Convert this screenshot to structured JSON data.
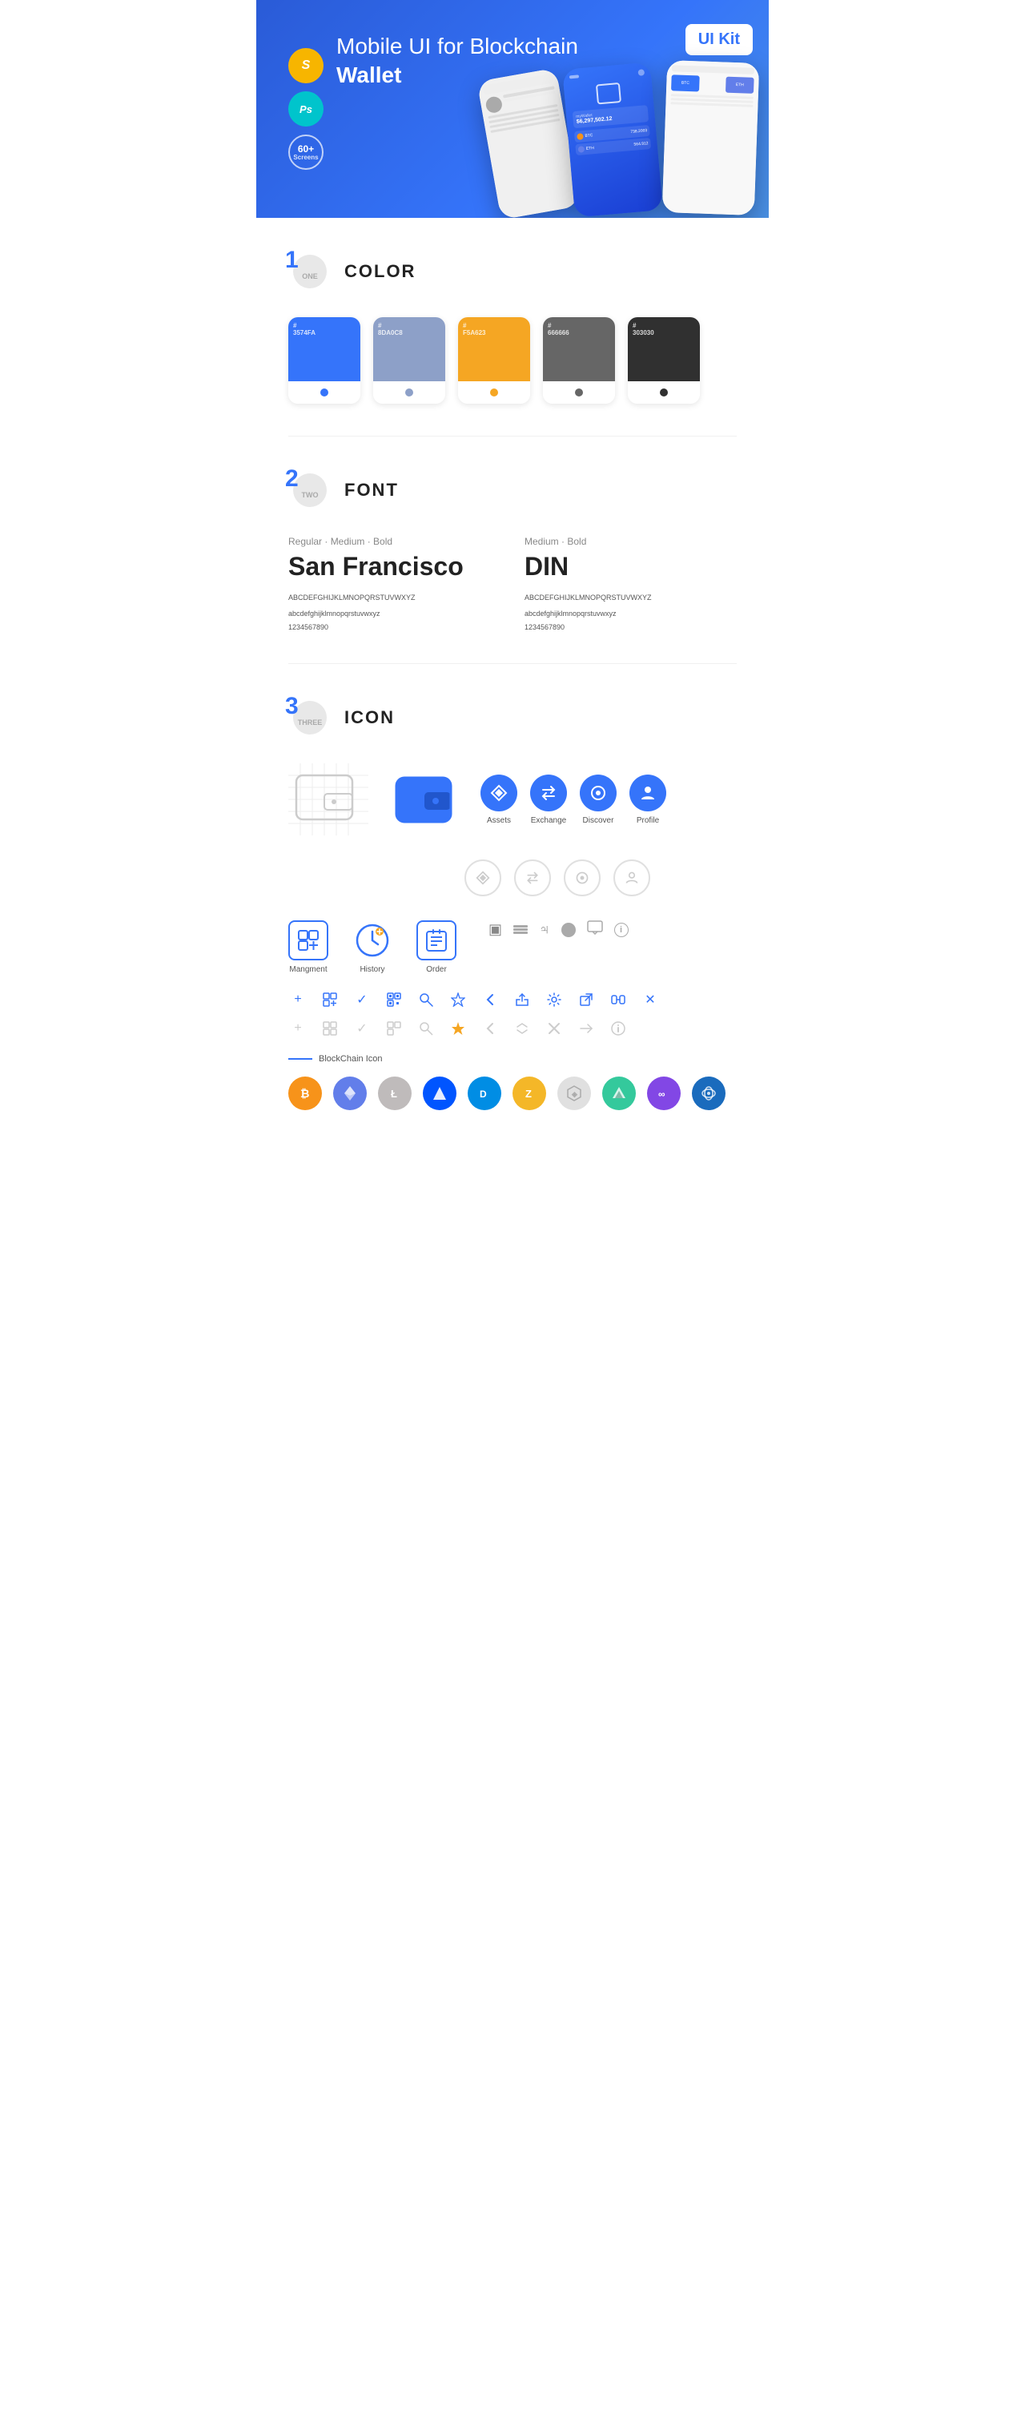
{
  "hero": {
    "title_plain": "Mobile UI for Blockchain ",
    "title_bold": "Wallet",
    "ui_kit_badge": "UI Kit",
    "badges": [
      {
        "label": "S",
        "sublabel": "",
        "type": "sketch"
      },
      {
        "label": "Ps",
        "sublabel": "",
        "type": "ps"
      },
      {
        "label": "60+",
        "sublabel": "Screens",
        "type": "screens"
      }
    ]
  },
  "sections": {
    "color": {
      "number": "1",
      "word": "ONE",
      "title": "COLOR",
      "swatches": [
        {
          "hex": "#3574FA",
          "label": "#\n3574FA"
        },
        {
          "hex": "#8DA0C8",
          "label": "#\n8DA0C8"
        },
        {
          "hex": "#F5A623",
          "label": "#\nF5A623"
        },
        {
          "hex": "#666666",
          "label": "#\n666666"
        },
        {
          "hex": "#303030",
          "label": "#\n303030"
        }
      ]
    },
    "font": {
      "number": "2",
      "word": "TWO",
      "title": "FONT",
      "fonts": [
        {
          "style_label": "Regular · Medium · Bold",
          "name": "San Francisco",
          "uppercase": "ABCDEFGHIJKLMNOPQRSTUVWXYZ",
          "lowercase": "abcdefghijklmnopqrstuvwxyz",
          "numbers": "1234567890"
        },
        {
          "style_label": "Medium · Bold",
          "name": "DIN",
          "uppercase": "ABCDEFGHIJKLMNOPQRSTUVWXYZ",
          "lowercase": "abcdefghijklmnopqrstuvwxyz",
          "numbers": "1234567890"
        }
      ]
    },
    "icon": {
      "number": "3",
      "word": "THREE",
      "title": "ICON",
      "nav_icons": [
        {
          "label": "Assets",
          "color": "blue"
        },
        {
          "label": "Exchange",
          "color": "blue"
        },
        {
          "label": "Discover",
          "color": "blue"
        },
        {
          "label": "Profile",
          "color": "blue"
        }
      ],
      "nav_icons_gray": [
        {
          "label": "",
          "color": "gray"
        },
        {
          "label": "",
          "color": "gray"
        },
        {
          "label": "",
          "color": "gray"
        },
        {
          "label": "",
          "color": "gray"
        }
      ],
      "app_icons": [
        {
          "label": "Mangment"
        },
        {
          "label": "History"
        },
        {
          "label": "Order"
        }
      ],
      "small_icons_row1_labels": [
        "+",
        "⊞",
        "✓",
        "⊞",
        "🔍",
        "☆",
        "<",
        "<",
        "⚙",
        "↗",
        "⇄",
        "✕"
      ],
      "small_icons_row2_labels": [
        "+",
        "⊞",
        "✓",
        "⊞",
        "🔍",
        "☆",
        "<",
        "↔",
        "✕",
        "→",
        "ℹ"
      ],
      "blockchain_label": "BlockChain Icon",
      "crypto": [
        "BTC",
        "ETH",
        "LTC",
        "WAVES",
        "DASH",
        "ZEC",
        "◈",
        "▲",
        "∞",
        "◯"
      ]
    }
  }
}
